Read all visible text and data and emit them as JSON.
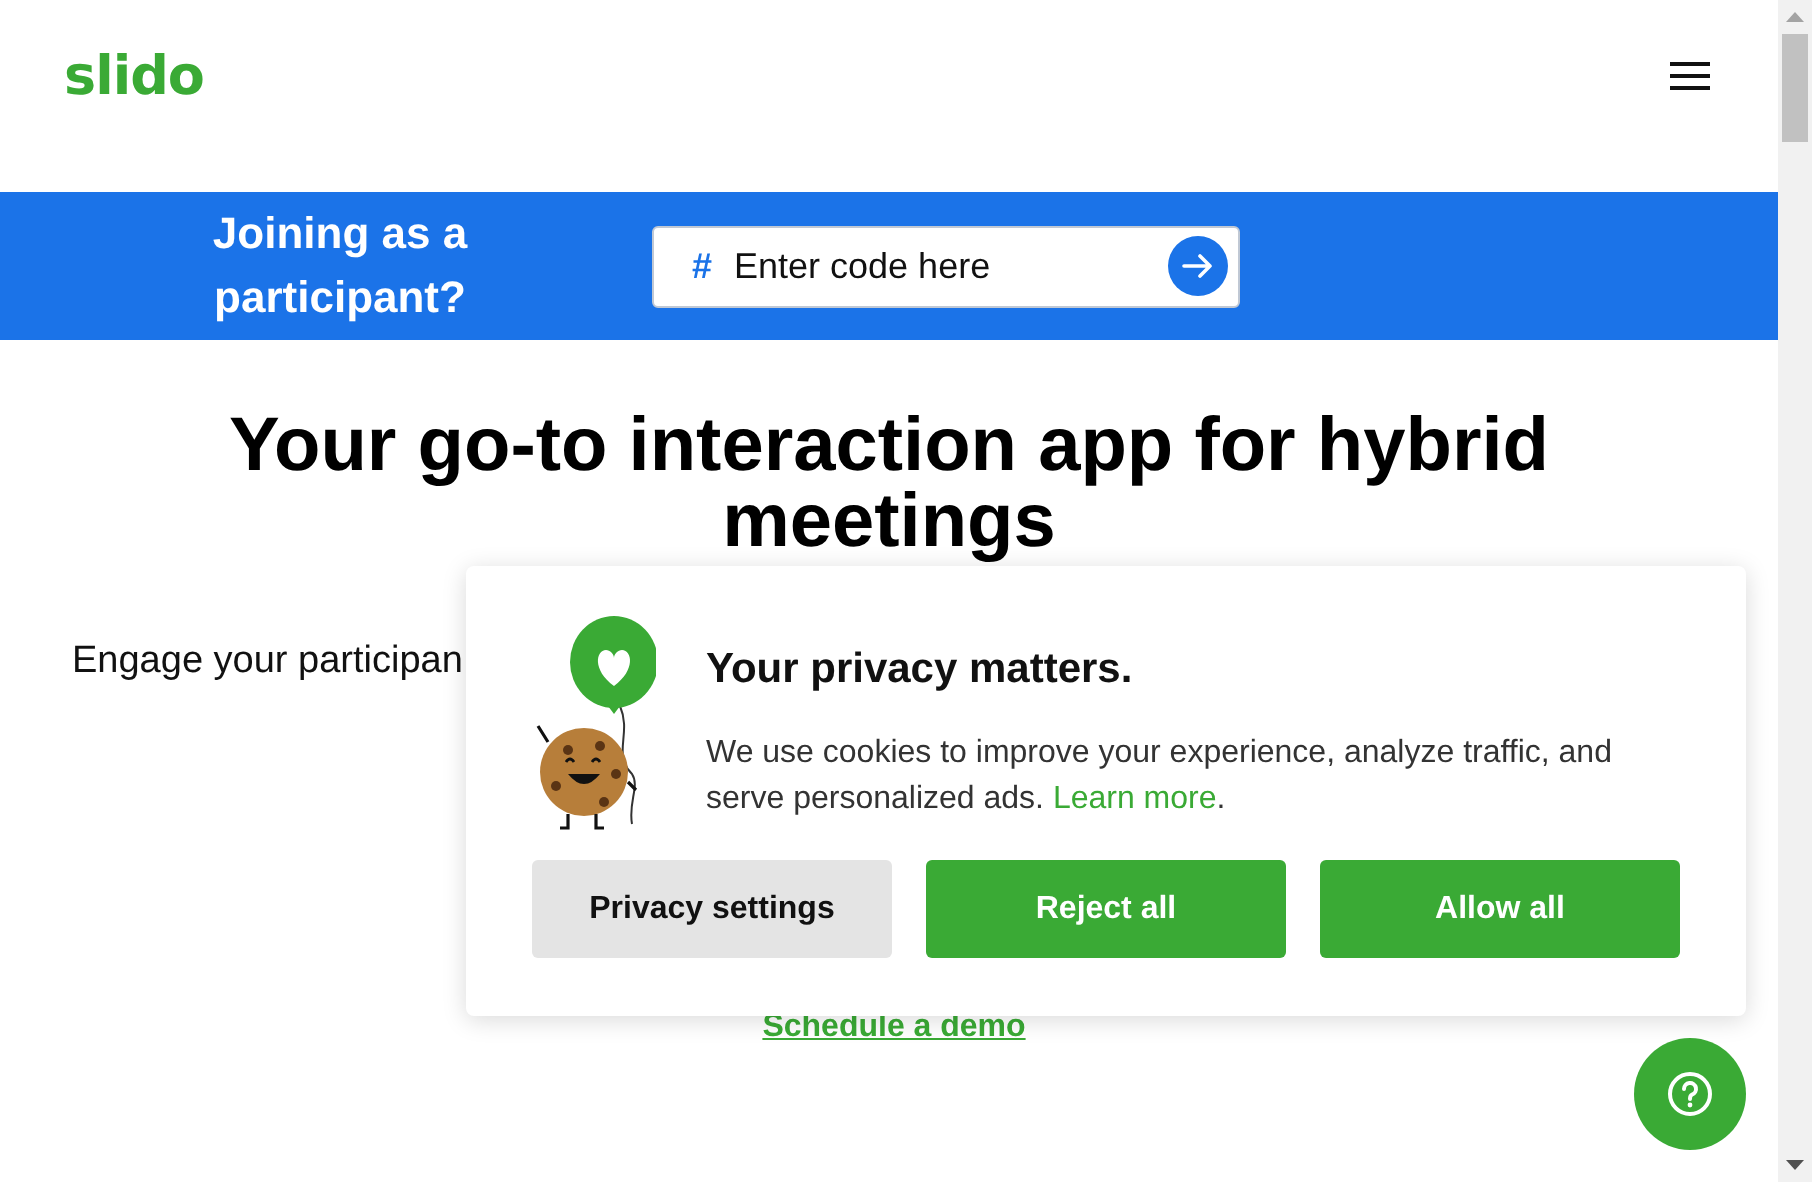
{
  "header": {
    "logo": "slido"
  },
  "join_bar": {
    "prompt": "Joining as a participant?",
    "code_field": {
      "prefix": "#",
      "placeholder": "Enter code here"
    }
  },
  "hero": {
    "heading": "Your go-to interaction app for hybrid",
    "heading_line_2": "meetings",
    "subtitle": "Engage your participan",
    "link": "Schedule a demo"
  },
  "cookie_dialog": {
    "title": "Your privacy matters.",
    "text": "We use cookies to improve your experience, analyze traffic, and serve personalized ads.",
    "link": "Learn more",
    "link_suffix": ".",
    "buttons": [
      {
        "label": "Privacy settings",
        "kind": "secondary"
      },
      {
        "label": "Reject all",
        "kind": "primary"
      },
      {
        "label": "Allow all",
        "kind": "primary"
      }
    ]
  }
}
